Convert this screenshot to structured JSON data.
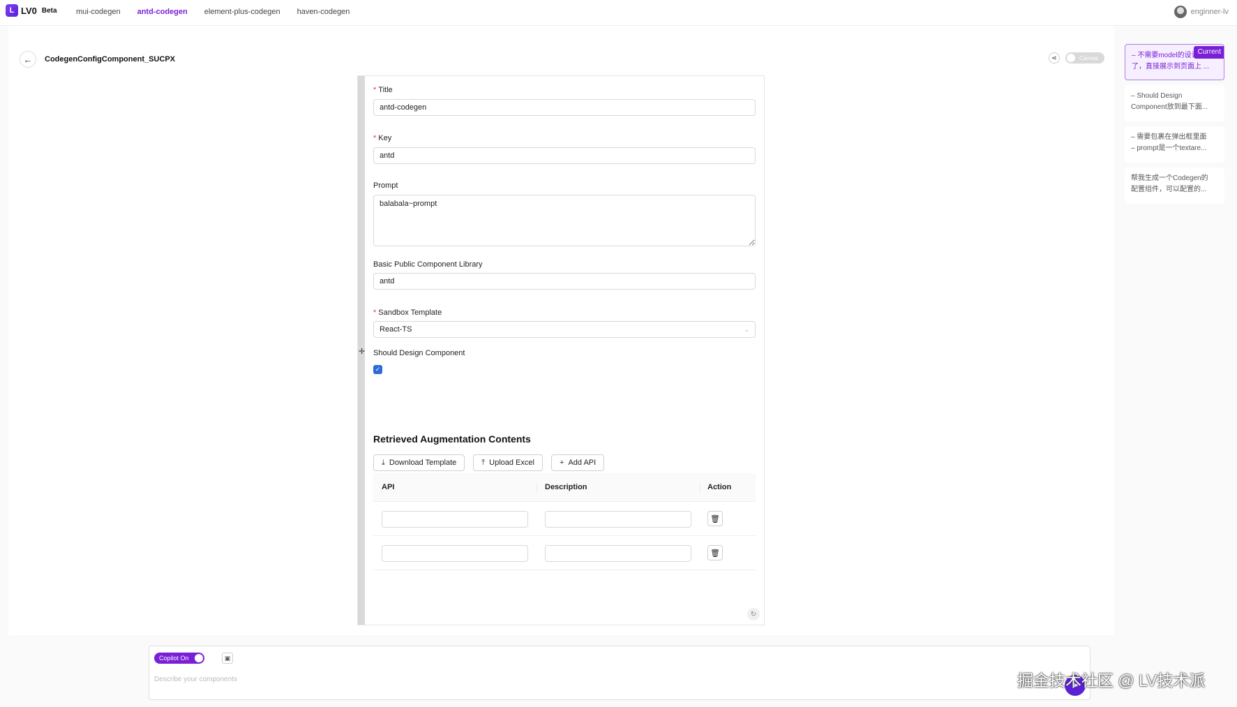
{
  "app": {
    "logo": "LV0",
    "beta": "Beta"
  },
  "nav": {
    "links": [
      "mui-codegen",
      "antd-codegen",
      "element-plus-codegen",
      "haven-codegen"
    ],
    "active_index": 1
  },
  "user": {
    "name": "enginner-lv"
  },
  "page": {
    "title": "CodegenConfigComponent_SUCPX",
    "canvas_label": "Canvas"
  },
  "form": {
    "title": {
      "label": "Title",
      "value": "antd-codegen"
    },
    "key": {
      "label": "Key",
      "value": "antd"
    },
    "prompt": {
      "label": "Prompt",
      "value": "balabala~prompt"
    },
    "library": {
      "label": "Basic Public Component Library",
      "value": "antd"
    },
    "sandbox": {
      "label": "Sandbox Template",
      "value": "React-TS"
    },
    "design": {
      "label": "Should Design Component",
      "checked": true
    },
    "section_title": "Retrieved Augmentation Contents",
    "buttons": {
      "download": "Download Template",
      "upload": "Upload Excel",
      "add": "Add API"
    },
    "table": {
      "headers": {
        "api": "API",
        "description": "Description",
        "action": "Action"
      },
      "rows": [
        {
          "api": "",
          "description": ""
        },
        {
          "api": "",
          "description": ""
        }
      ]
    }
  },
  "history": {
    "current_badge": "Current",
    "items": [
      {
        "line1": "– 不需要model的设计",
        "line2": "了，直接展示到页面上 ..."
      },
      {
        "line1": "– Should Design",
        "line2": "Component放到最下面..."
      },
      {
        "line1": "– 需要包裹在弹出框里面",
        "line2": "– prompt是一个textare..."
      },
      {
        "line1": "帮我生成一个Codegen的",
        "line2": "配置组件，可以配置的..."
      }
    ]
  },
  "copilot": {
    "toggle_label": "Copilot On",
    "placeholder": "Describe your components"
  },
  "watermark": "掘金技术社区 @ LV技术派",
  "colors": {
    "accent": "#7a1fd6",
    "checkbox": "#2d6bd8"
  },
  "icons": {
    "back": "arrow-left-icon",
    "share": "share-icon",
    "download": "download-icon",
    "upload": "upload-icon",
    "add": "plus-icon",
    "delete": "trash-icon",
    "refresh": "refresh-icon",
    "image": "image-icon",
    "send": "send-icon"
  }
}
